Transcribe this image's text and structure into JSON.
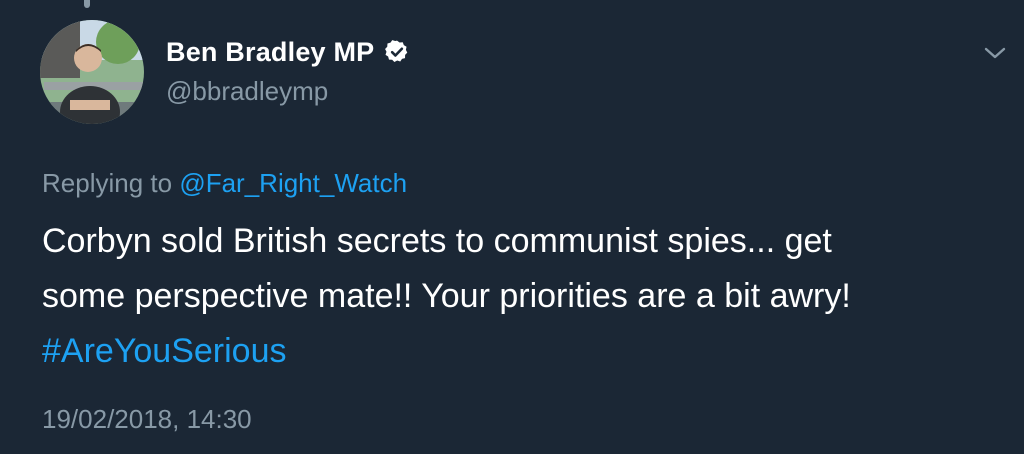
{
  "author": {
    "display_name": "Ben Bradley MP",
    "handle": "@bbradleymp",
    "verified": true
  },
  "reply": {
    "prefix": "Replying to ",
    "target": "@Far_Right_Watch"
  },
  "tweet": {
    "line1": "Corbyn sold British secrets to communist spies... get",
    "line2": "some perspective mate!! Your priorities are a bit awry!",
    "hashtag": "#AreYouSerious"
  },
  "timestamp": "19/02/2018, 14:30",
  "icons": {
    "verified": "verified-badge-icon",
    "menu": "chevron-down-icon"
  },
  "colors": {
    "background": "#1b2735",
    "text": "#ffffff",
    "secondary": "#8899a6",
    "link": "#1da1f2"
  }
}
